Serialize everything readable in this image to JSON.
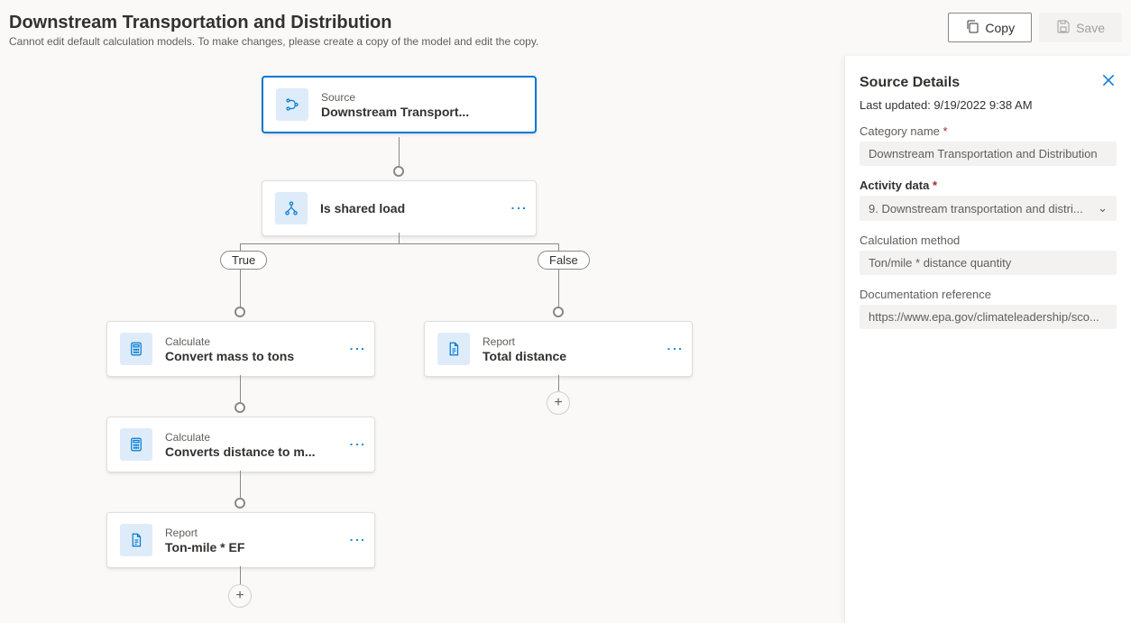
{
  "header": {
    "title": "Downstream Transportation and Distribution",
    "subtitle": "Cannot edit default calculation models. To make changes, please create a copy of the model and edit the copy.",
    "copy_label": "Copy",
    "save_label": "Save"
  },
  "flow": {
    "source": {
      "type": "Source",
      "label": "Downstream Transport..."
    },
    "condition": {
      "label": "Is shared load"
    },
    "true_label": "True",
    "false_label": "False",
    "true_branch": [
      {
        "type": "Calculate",
        "label": "Convert mass to tons"
      },
      {
        "type": "Calculate",
        "label": "Converts distance to m..."
      },
      {
        "type": "Report",
        "label": "Ton-mile * EF"
      }
    ],
    "false_branch": [
      {
        "type": "Report",
        "label": "Total distance"
      }
    ]
  },
  "panel": {
    "title": "Source Details",
    "last_updated": "Last updated: 9/19/2022 9:38 AM",
    "category_label": "Category name",
    "category_value": "Downstream Transportation and Distribution",
    "activity_label": "Activity data",
    "activity_value": "9. Downstream transportation and distri...",
    "method_label": "Calculation method",
    "method_value": "Ton/mile * distance quantity",
    "doc_label": "Documentation reference",
    "doc_value": "https://www.epa.gov/climateleadership/sco..."
  }
}
